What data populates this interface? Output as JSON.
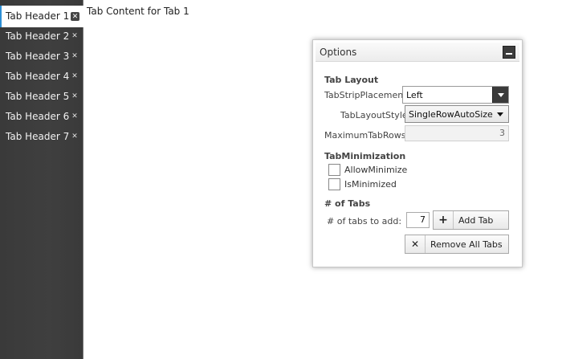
{
  "tabs": [
    {
      "label": "Tab Header 1",
      "selected": true
    },
    {
      "label": "Tab Header 2",
      "selected": false
    },
    {
      "label": "Tab Header 3",
      "selected": false
    },
    {
      "label": "Tab Header 4",
      "selected": false
    },
    {
      "label": "Tab Header 5",
      "selected": false
    },
    {
      "label": "Tab Header 6",
      "selected": false
    },
    {
      "label": "Tab Header 7",
      "selected": false
    }
  ],
  "content": {
    "text": "Tab Content for Tab 1"
  },
  "options": {
    "title": "Options",
    "tab_layout": {
      "section_title": "Tab Layout",
      "placement_label": "TabStripPlacement",
      "placement_value": "Left",
      "style_label": "TabLayoutStyle",
      "style_value": "SingleRowAutoSize",
      "max_rows_label": "MaximumTabRows",
      "max_rows_value": "3"
    },
    "minimization": {
      "section_title": "TabMinimization",
      "allow_minimize_label": "AllowMinimize",
      "allow_minimize_checked": false,
      "is_minimized_label": "IsMinimized",
      "is_minimized_checked": false
    },
    "num_tabs": {
      "section_title": "# of Tabs",
      "count_label": "# of tabs to add:",
      "count_value": "7",
      "add_label": "Add Tab",
      "add_icon": "plus-icon",
      "remove_label": "Remove All Tabs",
      "remove_icon": "x-icon"
    }
  },
  "colors": {
    "accent": "#2d8fd5",
    "tabstrip_bg": "#3c3c3c"
  }
}
